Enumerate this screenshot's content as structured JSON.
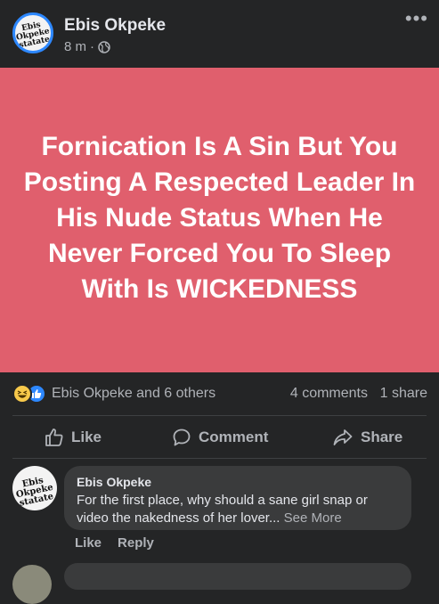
{
  "post": {
    "author": "Ebis Okpeke",
    "timestamp": "8 m",
    "separator": "·",
    "audience_icon": "globe-icon",
    "more_icon": "ellipsis-icon",
    "avatar_text": "Ebis Okpeke\nstatate",
    "text": "Fornication Is A Sin But You Posting A Respected Leader In His Nude Status When He Never Forced You To Sleep With Is WICKEDNESS",
    "background_color": "#e05f6d"
  },
  "stats": {
    "reaction_icons": [
      "haha-reaction-icon",
      "like-reaction-icon"
    ],
    "reactions_text": "Ebis Okpeke and 6 others",
    "comments_text": "4 comments",
    "shares_text": "1 share"
  },
  "actions": {
    "like_label": "Like",
    "comment_label": "Comment",
    "share_label": "Share"
  },
  "comments": [
    {
      "author": "Ebis Okpeke",
      "avatar_text": "Ebis Okpeke\nstatate",
      "text": "For the first place, why should a sane girl snap or video the nakedness of her lover...",
      "see_more": "See More",
      "like_label": "Like",
      "reply_label": "Reply"
    }
  ],
  "colors": {
    "background": "#242526",
    "bubble": "#3a3b3c",
    "accent": "#2d88ff",
    "secondary_text": "#b0b3b8"
  }
}
